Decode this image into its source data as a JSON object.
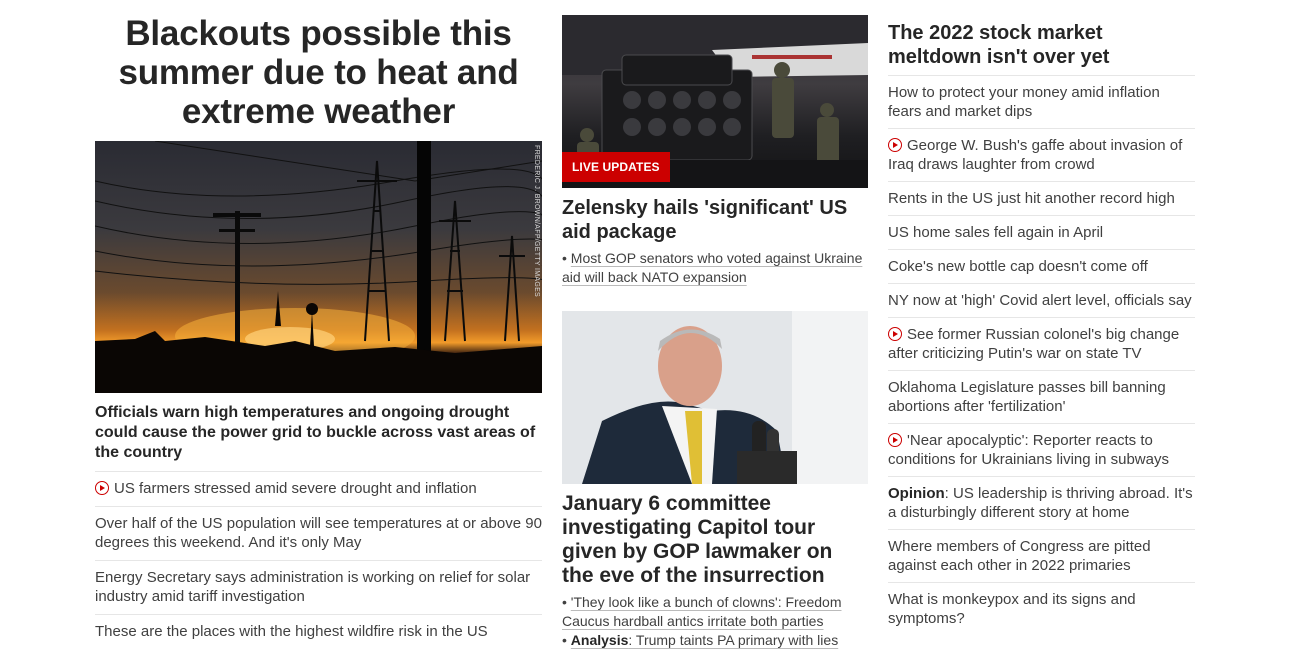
{
  "col1": {
    "headline": "Blackouts possible this summer due to heat and extreme weather",
    "photo_credit": "FREDERIC J. BROWN/AFP/GETTY IMAGES",
    "lead": "Officials warn high temperatures and ongoing drought could cause the power grid to buckle across vast areas of the country",
    "links": [
      "US farmers stressed amid severe drought and inflation",
      "Over half of the US population will see temperatures at or above 90 degrees this weekend. And it's only May",
      "Energy Secretary says administration is working on relief for solar industry amid tariff investigation",
      "These are the places with the highest wildfire risk in the US"
    ]
  },
  "col2": {
    "live_badge": "LIVE UPDATES",
    "story1_headline": "Zelensky hails 'significant' US aid package",
    "story1_bullet": "Most GOP senators who voted against Ukraine aid will back NATO expansion",
    "story2_headline": "January 6 committee investigating Capitol tour given by GOP lawmaker on the eve of the insurrection",
    "story2_bullet1": "'They look like a bunch of clowns': Freedom Caucus hardball antics irritate both parties",
    "story2_bullet2_label": "Analysis",
    "story2_bullet2_text": ": Trump taints PA primary with lies"
  },
  "col3": {
    "headline": "The 2022 stock market meltdown isn't over yet",
    "links": [
      "How to protect your money amid inflation fears and market dips",
      "George W. Bush's gaffe about invasion of Iraq draws laughter from crowd",
      "Rents in the US just hit another record high",
      "US home sales fell again in April",
      "Coke's new bottle cap doesn't come off",
      "NY now at 'high' Covid alert level, officials say",
      "See former Russian colonel's big change after criticizing Putin's war on state TV",
      "Oklahoma Legislature passes bill banning abortions after 'fertilization'",
      "'Near apocalyptic': Reporter reacts to conditions for Ukrainians living in subways",
      "Opinion",
      ": US leadership is thriving abroad. It's a disturbingly different story at home",
      "Where members of Congress are pitted against each other in 2022 primaries",
      "What is monkeypox and its signs and symptoms?"
    ]
  },
  "colors": {
    "accent": "#cc0000",
    "text": "#262626"
  },
  "icons": {
    "video": "play-circle-icon"
  }
}
